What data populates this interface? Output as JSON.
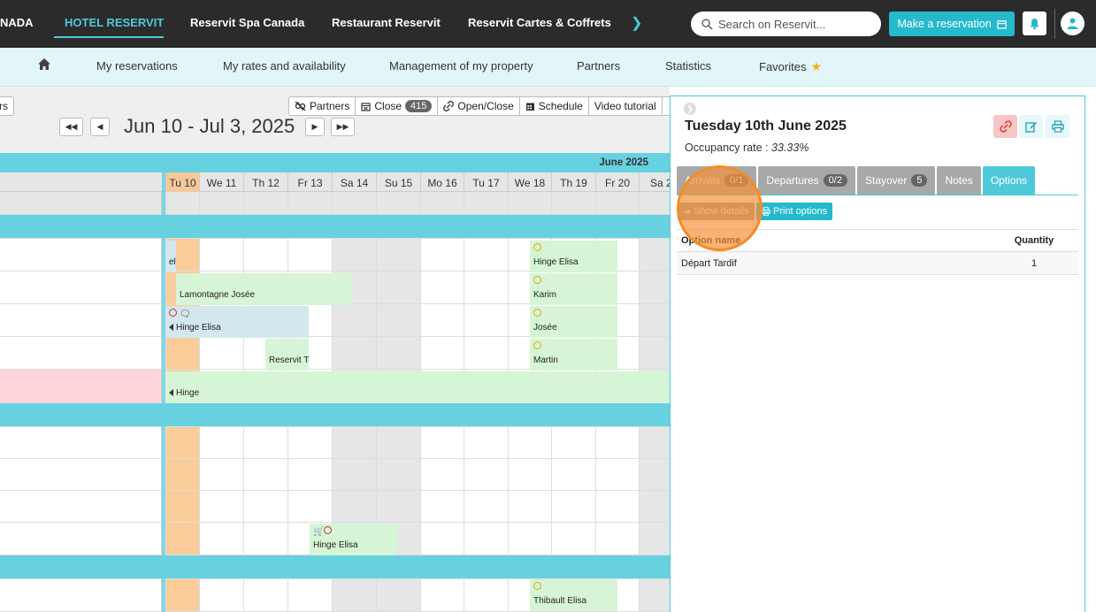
{
  "topnav": {
    "items": [
      {
        "label": "NADA"
      },
      {
        "label": "HOTEL RESERVIT"
      },
      {
        "label": "Reservit Spa Canada"
      },
      {
        "label": "Restaurant Reservit"
      },
      {
        "label": "Reservit Cartes & Coffrets"
      }
    ],
    "search_placeholder": "Search on Reservit...",
    "reserve_label": "Make a reservation"
  },
  "subnav": {
    "items": [
      {
        "label": "My reservations"
      },
      {
        "label": "My rates and availability"
      },
      {
        "label": "Management of my property"
      },
      {
        "label": "Partners"
      },
      {
        "label": "Statistics"
      },
      {
        "label": "Favorites"
      }
    ]
  },
  "calendar": {
    "rs_label": "rs",
    "toolbar": {
      "partners": "Partners",
      "close": "Close",
      "close_count": "415",
      "open_close": "Open/Close",
      "schedule": "Schedule",
      "video": "Video tutorial"
    },
    "date_range": "Jun 10 - Jul 3, 2025",
    "month_label": "June 2025",
    "days": [
      "Tu 10",
      "We 11",
      "Th 12",
      "Fr 13",
      "Sa 14",
      "Su 15",
      "Mo 16",
      "Tu 17",
      "We 18",
      "Th 19",
      "Fr 20",
      "Sa 2"
    ],
    "bookings": {
      "b1": "ele",
      "b2": "Hinge Elisa",
      "b3": "Lamontagne Josée",
      "b4": "Karim",
      "b5": "Hinge Elisa",
      "b6": "Josée",
      "b7": "Reservit Te",
      "b8": "Martin",
      "b9": "Hinge",
      "b10": "Hinge Elisa",
      "b11": "Thibault Elisa"
    }
  },
  "panel": {
    "title": "Tuesday 10th June 2025",
    "occupancy_label": "Occupancy rate :",
    "occupancy_value": "33.33%",
    "tabs": [
      {
        "label": "Arrivals",
        "badge": "0/1"
      },
      {
        "label": "Departures",
        "badge": "0/2"
      },
      {
        "label": "Stayover",
        "badge": "5"
      },
      {
        "label": "Notes",
        "badge": ""
      },
      {
        "label": "Options",
        "badge": ""
      }
    ],
    "show_details": "Show details",
    "print_options": "Print options",
    "table": {
      "headers": [
        "Option name",
        "Quantity"
      ],
      "rows": [
        [
          "Départ Tardif",
          "1"
        ]
      ]
    }
  },
  "colors": {
    "accent": "#4ec9da",
    "button": "#25b9cc",
    "topbar": "#2b2b2b",
    "today": "#f9cc99",
    "booking_green": "#d6f5d6",
    "booking_blue": "#d3e7ee",
    "highlight": "#f28c28"
  }
}
